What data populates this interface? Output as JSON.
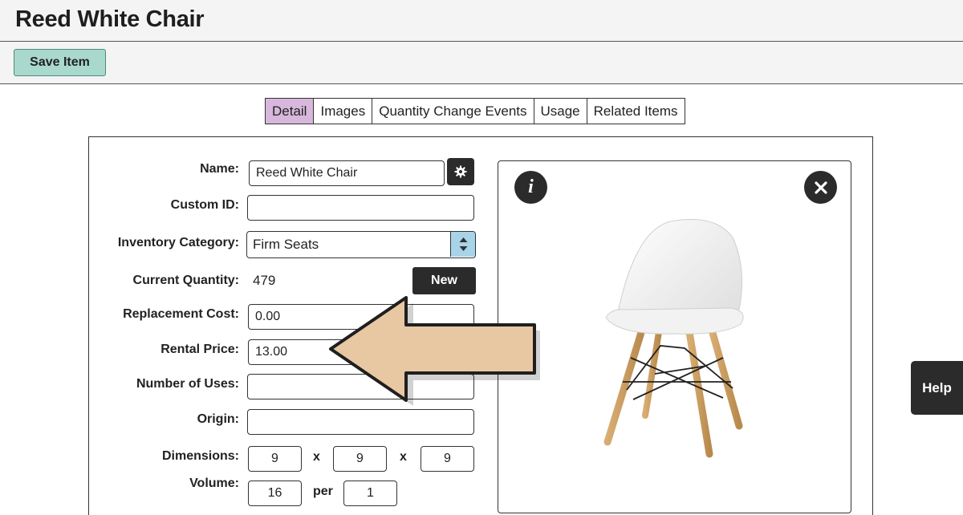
{
  "page": {
    "title": "Reed White Chair"
  },
  "toolbar": {
    "save_label": "Save Item"
  },
  "tabs": [
    {
      "label": "Detail",
      "active": true
    },
    {
      "label": "Images"
    },
    {
      "label": "Quantity Change Events"
    },
    {
      "label": "Usage"
    },
    {
      "label": "Related Items"
    }
  ],
  "form": {
    "name": {
      "label": "Name:",
      "value": "Reed White Chair"
    },
    "custom_id": {
      "label": "Custom ID:",
      "value": ""
    },
    "inventory_category": {
      "label": "Inventory Category:",
      "value": "Firm Seats"
    },
    "current_quantity": {
      "label": "Current Quantity:",
      "value": "479",
      "new_label": "New"
    },
    "replacement_cost": {
      "label": "Replacement Cost:",
      "value": "0.00"
    },
    "rental_price": {
      "label": "Rental Price:",
      "value": "13.00"
    },
    "number_of_uses": {
      "label": "Number of Uses:",
      "value": ""
    },
    "origin": {
      "label": "Origin:",
      "value": ""
    },
    "dimensions": {
      "label": "Dimensions:",
      "x": "9",
      "y": "9",
      "z": "9",
      "sep": "x"
    },
    "volume": {
      "label": "Volume:",
      "value": "16",
      "per_label": "per",
      "per_value": "1"
    }
  },
  "image_panel": {
    "info_label": "i"
  },
  "help": {
    "label": "Help"
  },
  "colors": {
    "save_button": "#a9d8cc",
    "active_tab": "#d8b7dc",
    "stepper": "#a8d4ea",
    "arrow": "#e8c7a3",
    "dark_button": "#2b2b2b"
  },
  "icons": [
    "gear-icon",
    "info-icon",
    "close-icon",
    "stepper-icon",
    "arrow-overlay"
  ]
}
